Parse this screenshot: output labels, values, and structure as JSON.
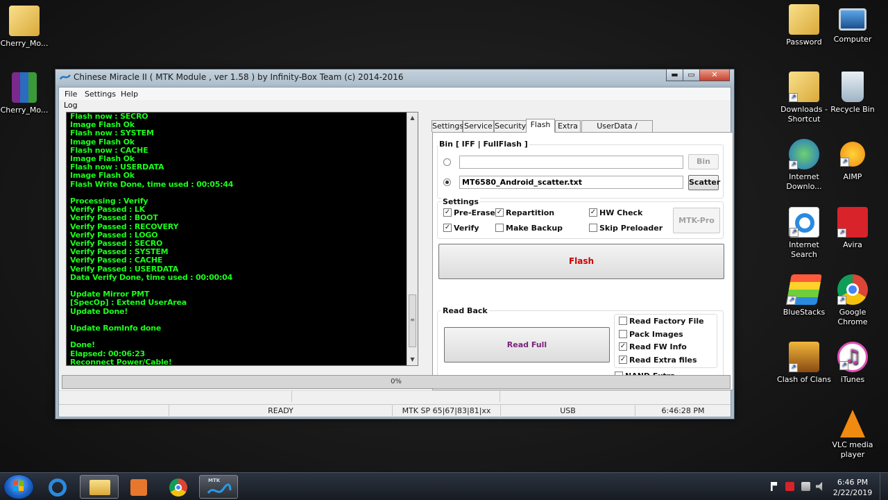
{
  "desktop": {
    "left_icons": [
      {
        "label": "Cherry_Mo..."
      },
      {
        "label": "Cherry_Mo..."
      }
    ],
    "right_icons": [
      {
        "label": "Password"
      },
      {
        "label": "Computer"
      },
      {
        "label": "Downloads - Shortcut"
      },
      {
        "label": "Recycle Bin"
      },
      {
        "label": "Internet Downlo..."
      },
      {
        "label": "AIMP"
      },
      {
        "label": "Internet Search"
      },
      {
        "label": "Avira"
      },
      {
        "label": "BlueStacks"
      },
      {
        "label": "Google Chrome"
      },
      {
        "label": "Clash of Clans"
      },
      {
        "label": "iTunes"
      },
      {
        "label": "VLC media player"
      }
    ]
  },
  "window": {
    "title": "Chinese Miracle II ( MTK Module , ver 1.58 ) by Infinity-Box Team (c) 2014-2016",
    "controls": {
      "minimize": "▬",
      "maximize": "▭",
      "close": "✕"
    }
  },
  "menu": {
    "file": "File",
    "settings": "Settings",
    "help": "Help"
  },
  "log": {
    "label": "Log",
    "lines": "Flash now : SECRO\nImage Flash Ok\nFlash now : SYSTEM\nImage Flash Ok\nFlash now : CACHE\nImage Flash Ok\nFlash now : USERDATA\nImage Flash Ok\nFlash Write Done, time used : 00:05:44\n\nProcessing : Verify\nVerify Passed : LK\nVerify Passed : BOOT\nVerify Passed : RECOVERY\nVerify Passed : LOGO\nVerify Passed : SECRO\nVerify Passed : SYSTEM\nVerify Passed : CACHE\nVerify Passed : USERDATA\nData Verify Done, time used : 00:00:04\n\nUpdate Mirror PMT\n[SpecOp] : Extend UserArea\nUpdate Done!\n\nUpdate RomInfo done\n\nDone!\nElapsed: 00:06:23\nReconnect Power/Cable!",
    "scroll_up": "▲",
    "scroll_down": "▼",
    "thumb_grip": "≡"
  },
  "tabs": [
    "Settings",
    "Service",
    "Security",
    "Flash",
    "Extra",
    "UserData / Forensic"
  ],
  "active_tab": "Flash",
  "flash": {
    "bin_group_label": "Bin  [ IFF | FullFlash ]",
    "bin_path": "",
    "bin_button": "Bin",
    "scatter_path": "MT6580_Android_scatter.txt",
    "scatter_button": "Scatter",
    "settings_group_label": "Settings",
    "options": [
      {
        "label": "Pre-Erase",
        "checked": true
      },
      {
        "label": "Repartition",
        "checked": true
      },
      {
        "label": "HW Check",
        "checked": true
      },
      {
        "label": "Verify",
        "checked": true
      },
      {
        "label": "Make Backup",
        "checked": false
      },
      {
        "label": "Skip Preloader",
        "checked": false
      }
    ],
    "mtk_pro_button": "MTK-Pro",
    "flash_button": "Flash",
    "flash_color": "#cc0000",
    "readback_group_label": "Read Back",
    "read_full_button": "Read Full",
    "read_full_color": "#7a1f7a",
    "readback_options": [
      {
        "label": "Read Factory File",
        "checked": false
      },
      {
        "label": "Pack Images",
        "checked": false
      },
      {
        "label": "Read FW Info",
        "checked": true
      },
      {
        "label": "Read Extra files",
        "checked": true
      },
      {
        "label": "NAND Extra",
        "checked": false
      }
    ]
  },
  "progress": {
    "text": "0%",
    "value": 0
  },
  "status": {
    "state": "READY",
    "chip": "MTK SP 65|67|83|81|xx",
    "port": "USB",
    "time": "6:46:28 PM"
  },
  "taskbar": {
    "clock_time": "6:46 PM",
    "clock_date": "2/22/2019",
    "miracle_badge": "MTK"
  }
}
